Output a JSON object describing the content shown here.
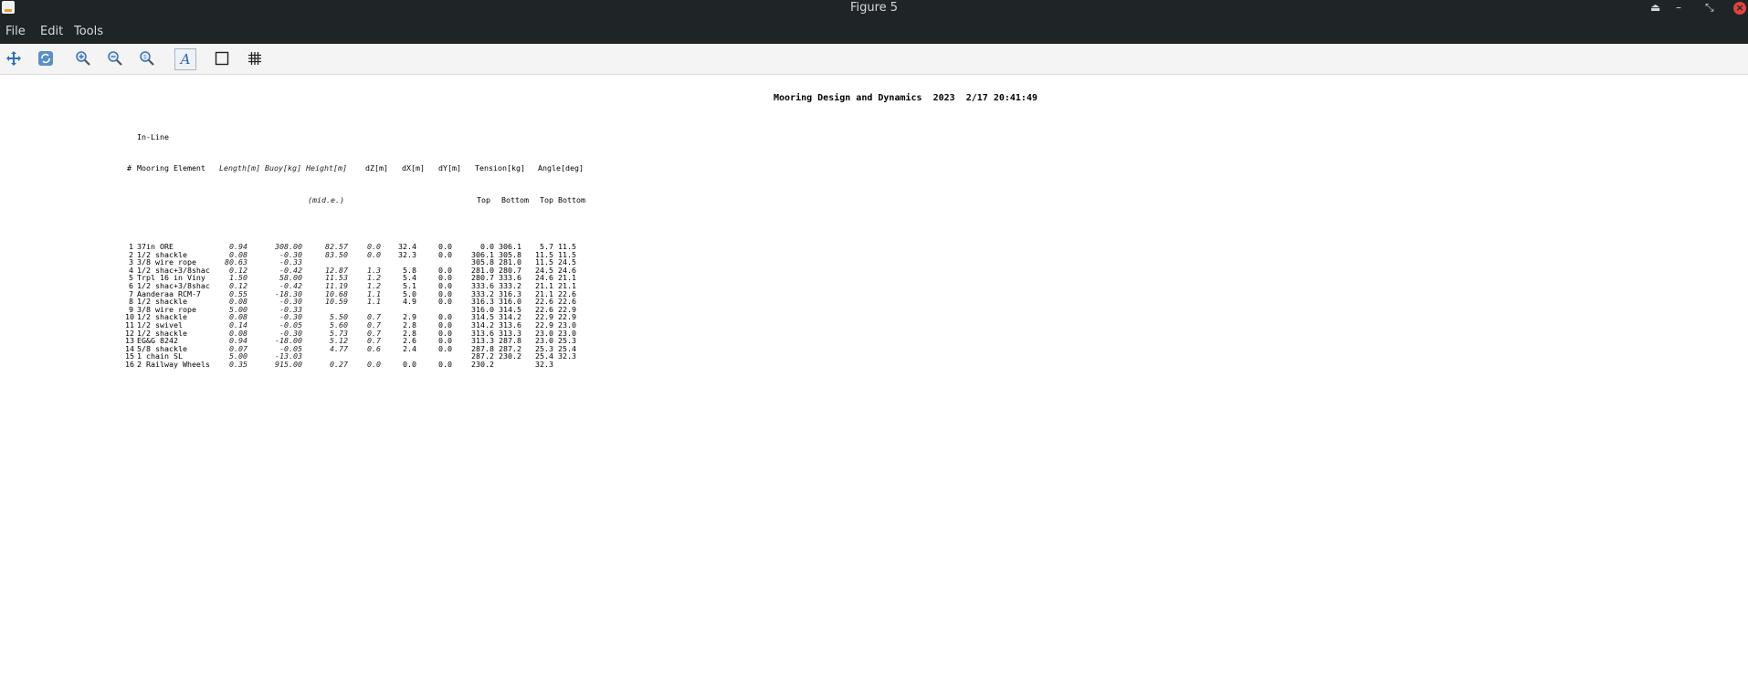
{
  "window": {
    "title": "Figure 5",
    "eject_icon": "eject-icon",
    "minimize_icon": "minimize-icon",
    "restore_icon": "restore-icon",
    "close_icon": "close-icon"
  },
  "menu": {
    "file": "File",
    "edit": "Edit",
    "tools": "Tools"
  },
  "toolbar": [
    {
      "name": "pan-icon"
    },
    {
      "name": "refresh-icon"
    },
    {
      "name": "zoom-in-icon"
    },
    {
      "name": "zoom-out-icon"
    },
    {
      "name": "zoom-reset-icon"
    },
    {
      "name": "text-icon"
    },
    {
      "name": "box-icon"
    },
    {
      "name": "grid-icon"
    }
  ],
  "figure": {
    "title": "Mooring Design and Dynamics  2023  2/17 20:41:49",
    "header": {
      "num": "#",
      "inline1": "In-Line",
      "element": "Mooring Element",
      "length": "Length[m]",
      "buoy": "Buoy[kg]",
      "height1": "Height[m]",
      "height2": "(mid.e.)",
      "dz": "dZ[m]",
      "dx": "dX[m]",
      "dy": "dY[m]",
      "tension": "Tension[kg]",
      "t_top": "Top",
      "t_bottom": "Bottom",
      "angle": "Angle[deg]",
      "a_top": "Top",
      "a_bottom": "Bottom"
    },
    "rows": [
      [
        "1",
        "37in ORE",
        "0.94",
        "308.00",
        "82.57",
        "0.0",
        "32.4",
        "0.0",
        "0.0",
        "306.1",
        "5.7",
        "11.5"
      ],
      [
        "2",
        "1/2 shackle",
        "0.08",
        "-0.30",
        "83.50",
        "0.0",
        "32.3",
        "0.0",
        "306.1",
        "305.8",
        "11.5",
        "11.5"
      ],
      [
        "3",
        "3/8 wire rope",
        "80.63",
        "-0.33",
        "",
        "",
        "",
        "",
        "305.8",
        "281.0",
        "11.5",
        "24.5"
      ],
      [
        "4",
        "1/2 shac+3/8shac",
        "0.12",
        "-0.42",
        "12.87",
        "1.3",
        "5.8",
        "0.0",
        "281.0",
        "280.7",
        "24.5",
        "24.6"
      ],
      [
        "5",
        "Trpl 16 in Viny",
        "1.50",
        "58.00",
        "11.53",
        "1.2",
        "5.4",
        "0.0",
        "280.7",
        "333.6",
        "24.6",
        "21.1"
      ],
      [
        "6",
        "1/2 shac+3/8shac",
        "0.12",
        "-0.42",
        "11.19",
        "1.2",
        "5.1",
        "0.0",
        "333.6",
        "333.2",
        "21.1",
        "21.1"
      ],
      [
        "7",
        "Aanderaa RCM-7",
        "0.55",
        "-18.30",
        "10.68",
        "1.1",
        "5.0",
        "0.0",
        "333.2",
        "316.3",
        "21.1",
        "22.6"
      ],
      [
        "8",
        "1/2 shackle",
        "0.08",
        "-0.30",
        "10.59",
        "1.1",
        "4.9",
        "0.0",
        "316.3",
        "316.0",
        "22.6",
        "22.6"
      ],
      [
        "9",
        "3/8 wire rope",
        "5.00",
        "-0.33",
        "",
        "",
        "",
        "",
        "316.0",
        "314.5",
        "22.6",
        "22.9"
      ],
      [
        "10",
        "1/2 shackle",
        "0.08",
        "-0.30",
        "5.50",
        "0.7",
        "2.9",
        "0.0",
        "314.5",
        "314.2",
        "22.9",
        "22.9"
      ],
      [
        "11",
        "1/2 swivel",
        "0.14",
        "-0.05",
        "5.60",
        "0.7",
        "2.8",
        "0.0",
        "314.2",
        "313.6",
        "22.9",
        "23.0"
      ],
      [
        "12",
        "1/2 shackle",
        "0.08",
        "-0.30",
        "5.73",
        "0.7",
        "2.8",
        "0.0",
        "313.6",
        "313.3",
        "23.0",
        "23.0"
      ],
      [
        "13",
        "EG&G 8242",
        "0.94",
        "-18.00",
        "5.12",
        "0.7",
        "2.6",
        "0.0",
        "313.3",
        "287.8",
        "23.0",
        "25.3"
      ],
      [
        "14",
        "5/8 shackle",
        "0.07",
        "-0.05",
        "4.77",
        "0.6",
        "2.4",
        "0.0",
        "287.8",
        "287.2",
        "25.3",
        "25.4"
      ],
      [
        "15",
        "1 chain SL",
        "5.00",
        "-13.03",
        "",
        "",
        "",
        "",
        "287.2",
        "230.2",
        "25.4",
        "32.3"
      ],
      [
        "16",
        "2 Railway Wheels",
        "0.35",
        "915.00",
        "0.27",
        "0.0",
        "0.0",
        "0.0",
        "230.2",
        "",
        "32.3",
        ""
      ]
    ]
  }
}
